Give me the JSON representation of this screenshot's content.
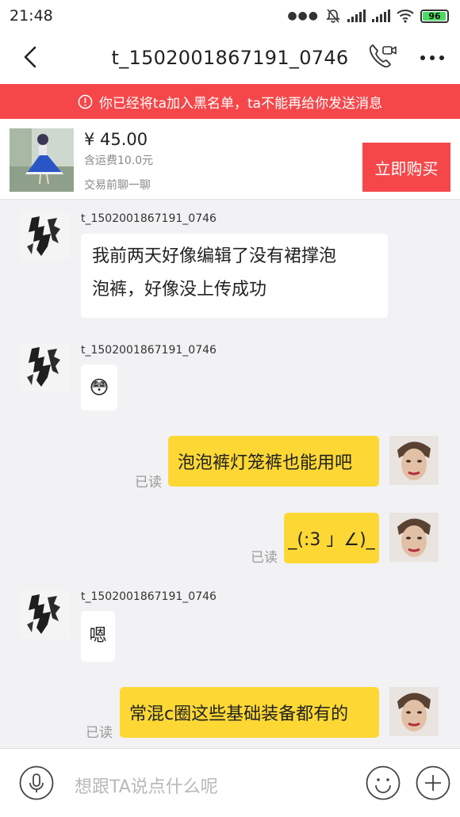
{
  "status_bar": {
    "time": "21:48",
    "battery": "96",
    "battery_level": 0.96
  },
  "header": {
    "title": "t_1502001867191_0746"
  },
  "blacklist_banner": {
    "text": "你已经将ta加入黑名单，ta不能再给你发送消息"
  },
  "product": {
    "price": "¥ 45.00",
    "shipping": "含运费10.0元",
    "chat_hint": "交易前聊一聊",
    "buy_label": "立即购买"
  },
  "messages": [
    {
      "side": "in",
      "sender": "t_1502001867191_0746",
      "lines": [
        "我前两天好像编辑了没有裙撑泡",
        "泡裤，好像没上传成功"
      ]
    },
    {
      "side": "in",
      "sender": "t_1502001867191_0746",
      "emoji": "😳"
    },
    {
      "side": "out",
      "text": "泡泡裤灯笼裤也能用吧",
      "status": "已读"
    },
    {
      "side": "out",
      "text": "_(:3 」∠)_",
      "status": "已读"
    },
    {
      "side": "in",
      "sender": "t_1502001867191_0746",
      "text": "嗯"
    },
    {
      "side": "out",
      "text": "常混c圈这些基础装备都有的",
      "status": "已读"
    }
  ],
  "input": {
    "placeholder": "想跟TA说点什么呢"
  },
  "icons": {
    "back": "back-arrow-icon",
    "call": "phone-video-icon",
    "more": "more-icon",
    "warning": "info-circle-icon",
    "voice": "microphone-icon",
    "emoji": "smiley-icon",
    "add": "plus-icon"
  },
  "colors": {
    "accent_red": "#f5474a",
    "outgoing_bubble": "#fdd835",
    "chat_background": "#f2f2f4"
  }
}
